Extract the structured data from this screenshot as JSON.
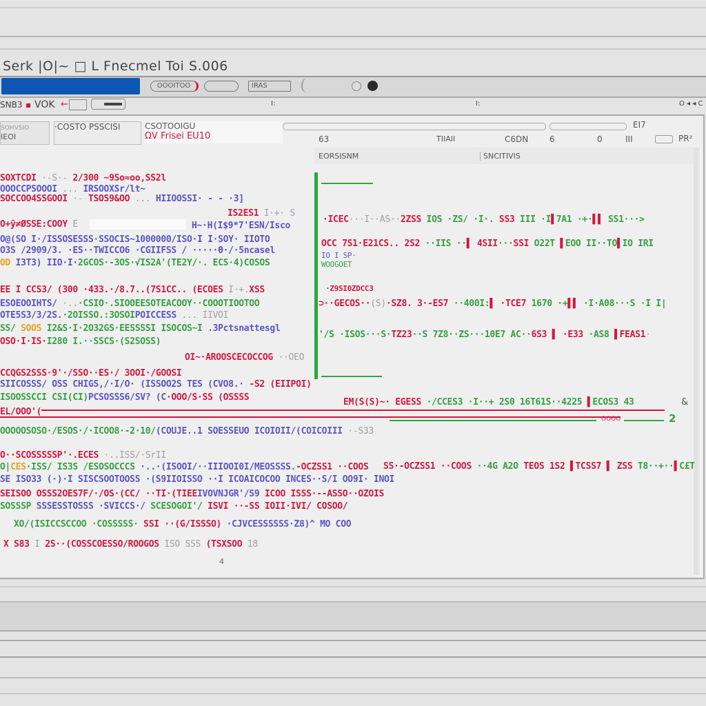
{
  "window": {
    "title": "Serk |O|~ □ L Fnecmel Toi S.006"
  },
  "toolbar": {
    "field1": "OOOITOO",
    "field2": "",
    "field3": "IRAS",
    "toolbar2_label": "SNB3",
    "toolbar2_text": "VOK",
    "toolbar2_mid": "I:",
    "toolbar2_right": "O ◂ ◂ C"
  },
  "tabs": [
    {
      "label": "SOHVSIO",
      "sub": "IEOI"
    },
    {
      "label": "·COSTO PSSCISI",
      "sub": ""
    },
    {
      "label": "CSOTOOIGU",
      "sub": "ΩV Frisei EU10"
    }
  ],
  "tab_extra": {
    "a": "63",
    "b": "TIIAII",
    "c": "C6DN",
    "d": "6",
    "e": "0",
    "f": "III",
    "g": "PR²",
    "h": "EI7"
  },
  "header": {
    "left": "EORSISNM",
    "right": "SNCITIVIS"
  },
  "colors": {
    "add": "#36a043",
    "del": "#d3173e",
    "mod": "#5a55c4",
    "accent": "#0d57b3"
  },
  "left_lines": [
    [
      [
        "r",
        "SOXTCDI"
      ],
      [
        "gr",
        " ·-S·- "
      ],
      [
        "r",
        "2/300"
      ],
      [
        "r",
        " ~9So≈oo,SS2l"
      ]
    ],
    [
      [
        "b",
        "OOOCCPSOOOI"
      ],
      [
        "gr",
        " ... "
      ],
      [
        "b",
        "IRSOOXSr/lt~"
      ]
    ],
    [
      [
        "r",
        "SOCCOO4SSGOOI"
      ],
      [
        "gr",
        " ·- "
      ],
      [
        "r",
        "TSOS9&OO"
      ],
      [
        "gr",
        " ... "
      ],
      [
        "b",
        "HIIOOSSI· - - ·3]"
      ]
    ],
    [
      [
        "r",
        "IS2ES1"
      ],
      [
        "gr",
        " I·+· S"
      ]
    ],
    [
      [
        "r",
        "O+ŷ≠ØSSE:COOY"
      ],
      [
        "gr",
        " E"
      ]
    ],
    [
      [
        "b",
        "H~·H(I$9*7'ESN/Isco"
      ]
    ],
    [
      [
        "b",
        "O@(SO"
      ],
      [
        "b",
        " I·/ISSOSESSS·SSOCIS~1000000/ISO·I I·SOY· IIOTO"
      ]
    ],
    [
      [
        "b",
        "O3S /2909/3.  ·ES··TWICCO6 ·CGIIFSS  /  ·····Ɵ·/·5ncasel"
      ]
    ],
    [
      [
        "o",
        "OD"
      ],
      [
        "b",
        " I3T3) IIO·I·"
      ],
      [
        "g",
        "2GCOS·-3OS·√"
      ],
      [
        "g",
        "IS2A'(TE2Y/·. ECS·4)COSOS"
      ]
    ],
    [
      [
        "r",
        "EE I CCS3/ (300 ·433.·/8.7.."
      ],
      [
        "r",
        "(7S1CC.."
      ],
      [
        "r",
        " (ECOES"
      ],
      [
        "gr",
        " I·+."
      ],
      [
        "r",
        "XSS"
      ]
    ],
    [
      [
        "b",
        "ESOEOOIHTS/"
      ],
      [
        "gr",
        " ·.."
      ],
      [
        "g",
        "·CSIO·.SIOOEESOTEACOOY·"
      ],
      [
        "g",
        "·COOOTIOOTOO"
      ]
    ],
    [
      [
        "b",
        "OTE5S3/3/2S."
      ],
      [
        "g",
        "·2OISSO.:3OSOI"
      ],
      [
        "b",
        "POICCESS"
      ],
      [
        "gr",
        "  ...  IIVOI"
      ]
    ],
    [
      [
        "g",
        "SS/"
      ],
      [
        "o",
        " SOOS"
      ],
      [
        "g",
        " I2&S·I·"
      ],
      [
        "g",
        "2O32GS·EESSSSI ISOCOS~I"
      ],
      [
        "b",
        "  .3Pctsnattesgl"
      ]
    ],
    [
      [
        "r",
        "OSO·I·IS·"
      ],
      [
        "g",
        "I280 I.··SSCS·(S2SOSS)"
      ]
    ],
    [
      [
        "r",
        "OI~·AROOSCECOCCOG"
      ],
      [
        "gr",
        " ··OEO"
      ]
    ],
    [
      [
        "r",
        "CCQGS2SSS·9'·/SSO·"
      ],
      [
        "r",
        "·ES·/ "
      ],
      [
        "r",
        "3OOI·/GOOSI"
      ]
    ],
    [
      [
        "b",
        "SIICOSSS/ "
      ],
      [
        "b",
        "OSS CHIGS,/·I/O· "
      ],
      [
        "b",
        "(ISSOO2S TES (CVO8.·"
      ],
      [
        "r",
        " -S2 (EIIPOI)"
      ]
    ],
    [
      [
        "g",
        "ISOOSSCCI CSI(CI)"
      ],
      [
        "b",
        "PCSOSSS6/SV? (C"
      ],
      [
        "r",
        "·OOO/S·SS (OSSSS"
      ]
    ],
    [
      [
        "r",
        "EL/OOO'("
      ]
    ],
    [
      [
        "g",
        "OOOOOSOSO·/ESOS·/·"
      ],
      [
        "g",
        "ICOO8·-2·10/"
      ],
      [
        "b",
        "(COUJE..1 SOESSEUO"
      ],
      [
        "b",
        " ICOIOII/(COICOIII"
      ],
      [
        "gr",
        " ·-S33"
      ]
    ],
    [
      [
        "r",
        "O··SCOSSSSSP'"
      ],
      [
        "r",
        "·.ECES"
      ],
      [
        "gr",
        " ·..ISS/·SrII"
      ]
    ],
    [
      [
        "g",
        "O|"
      ],
      [
        "o",
        "CES"
      ],
      [
        "g",
        "·ISS/ IS3S /"
      ],
      [
        "g",
        "ESOSOCCCS"
      ],
      [
        "b",
        " ·..·(ISOOI/··IIIOOI0I/MEOSSSS."
      ],
      [
        "r",
        "-OCZSS1 ··COOS"
      ]
    ],
    [
      [
        "b",
        "SE ISO33 (·)·I SISCSOOTOOSS ·(S9IIOISSO"
      ],
      [
        "b",
        " ··I ICOAICOCOO INCES··S/I OO9I· INOI"
      ]
    ],
    [
      [
        "r",
        "SEISOO "
      ],
      [
        "r",
        "OSSS2OES7F/·/OS·(CC/"
      ],
      [
        "r",
        " ··TI·(TIEE"
      ],
      [
        "b",
        "IVOVNJGR'/S9"
      ],
      [
        "r",
        " ICOO ISSS·--ASSO··OZOIS"
      ]
    ],
    [
      [
        "g",
        "SOSSSP "
      ],
      [
        "b",
        "SSSESSTOSSS"
      ],
      [
        "b",
        " ·SVICCS·/ "
      ],
      [
        "g",
        "SCESOGOI'/"
      ],
      [
        "r",
        " ISVI ··-SS IOII·IVI/ COSOO/"
      ]
    ],
    [
      [
        "g",
        "XO/(ISICCSCCOO ·COSSSSS· "
      ],
      [
        "r",
        "SSI"
      ],
      [
        "r",
        " ··(G/ISSSO)"
      ],
      [
        "b",
        " ·CJVCESSSSSS·Z8)^"
      ],
      [
        "b",
        " MO COO"
      ]
    ],
    [
      [
        "r",
        "X S83"
      ],
      [
        "gr",
        " I"
      ],
      [
        "r",
        " 2S··(COSSCOESSO/"
      ],
      [
        "r",
        "ROOGOS"
      ],
      [
        "gr",
        " ISO SSS"
      ],
      [
        "r",
        " (TSXSOO"
      ],
      [
        "gr",
        " 18"
      ]
    ]
  ],
  "right_lines": [
    [
      [
        "r",
        "·ICEC"
      ],
      [
        "gr",
        "···I··AS··"
      ],
      [
        "r",
        "2ZSS"
      ],
      [
        "g",
        " IOS ·ZS/ ·I·."
      ],
      [
        "r",
        " SS3"
      ],
      [
        "g",
        " III ·I"
      ],
      [
        "r",
        "▌"
      ],
      [
        "g",
        "7A1 ·+·"
      ],
      [
        "r",
        "▌▌"
      ],
      [
        "g",
        " SS1···>"
      ]
    ],
    [
      [
        "r",
        "OCC 7S1·"
      ],
      [
        "r",
        "E21CS.. "
      ],
      [
        "r",
        "2S2"
      ],
      [
        "g",
        " ··IIS ··"
      ],
      [
        "r",
        "▌ 4SII"
      ],
      [
        "g",
        "···"
      ],
      [
        "r",
        "SSI"
      ],
      [
        "g",
        " O22T "
      ],
      [
        "r",
        "▌"
      ],
      [
        "g",
        "EOO II··TO"
      ],
      [
        "r",
        "▌"
      ],
      [
        "g",
        "IO IRI"
      ]
    ],
    [
      [
        "b",
        "IO I SP·"
      ]
    ],
    [
      [
        "g",
        "WOOGOET"
      ]
    ],
    [
      [
        "r",
        "·Z9SI0ZDCC3"
      ]
    ],
    [
      [
        "r",
        "⊃··GECOS··"
      ],
      [
        "gr",
        "(S)"
      ],
      [
        "r",
        "·SZ8. 3·-ES7"
      ],
      [
        "g",
        " ··400I:"
      ],
      [
        "r",
        "▌"
      ],
      [
        "r",
        " ·TCE7"
      ],
      [
        "g",
        " 1670 ·+"
      ],
      [
        "r",
        "▌▌"
      ],
      [
        "g",
        " ·I·A08···S ·I I|"
      ]
    ],
    [
      [
        "g",
        "'/S ·ISOS···S·"
      ],
      [
        "r",
        "TZ23"
      ],
      [
        "g",
        "··S 7Z8··ZS··"
      ],
      [
        "g",
        "·10E7 AC··"
      ],
      [
        "r",
        "6S3"
      ],
      [
        "r",
        " ▌"
      ],
      [
        "r",
        " ·E33"
      ],
      [
        "g",
        " ·AS8"
      ],
      [
        "r",
        " ▌"
      ],
      [
        "r",
        "FEAS1"
      ],
      [
        "gr",
        "·"
      ]
    ],
    [
      [
        "r",
        "EM(S(S)~· "
      ],
      [
        "r",
        "EGESS"
      ],
      [
        "g",
        " ·/CCES3"
      ],
      [
        "g",
        " ·I··+ 2S0 16T61S·"
      ],
      [
        "g",
        "·4225"
      ],
      [
        "r",
        " ▌"
      ],
      [
        "g",
        "ECOS3 43"
      ]
    ],
    [
      [
        "r",
        "SS·"
      ],
      [
        "r",
        "-OCZSS1"
      ],
      [
        "r",
        " ··COOS"
      ],
      [
        "g",
        " ··4G A2O"
      ],
      [
        "r",
        " TEOS"
      ],
      [
        "r",
        " 1S2"
      ],
      [
        "r",
        " ▌"
      ],
      [
        "r",
        "TCSS7"
      ],
      [
        "r",
        "  ▌"
      ],
      [
        "r",
        " ZSS"
      ],
      [
        "g",
        " T8··+··"
      ],
      [
        "r",
        "▌"
      ],
      [
        "g",
        "C£T"
      ]
    ]
  ],
  "markers": {
    "diff_count": "OOOO",
    "hunk": "2",
    "caret": "&",
    "footer_mark": "4"
  }
}
